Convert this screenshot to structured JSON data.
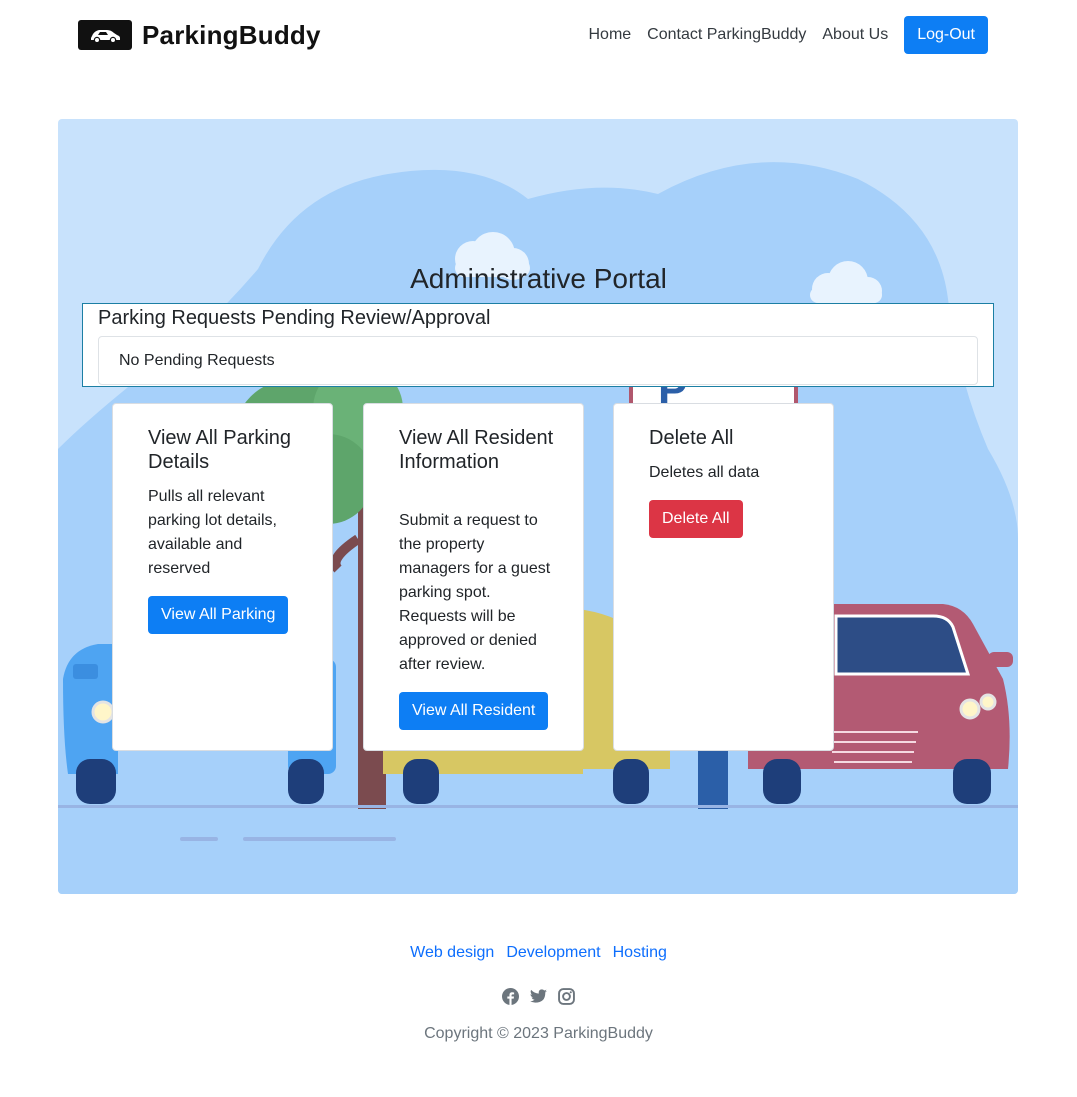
{
  "header": {
    "brand": "ParkingBuddy",
    "logo_icon": "car-icon",
    "nav": [
      "Home",
      "Contact ParkingBuddy",
      "About Us"
    ],
    "logout_label": "Log-Out"
  },
  "portal": {
    "title": "Administrative Portal",
    "requests_title": "Parking Requests Pending Review/Approval",
    "requests_empty": "No Pending Requests"
  },
  "cards": [
    {
      "title": "View All Parking Details",
      "text": "Pulls all relevant parking lot details, available and reserved",
      "button": "View All Parking"
    },
    {
      "title": "View All Resident Information",
      "text": "Submit a request to the property managers for a guest parking spot. Requests will be approved or denied after review.",
      "button": "View All Resident"
    },
    {
      "title": "Delete All",
      "text": "Deletes all data",
      "button": "Delete All"
    }
  ],
  "footer": {
    "links": [
      "Web design",
      "Development",
      "Hosting"
    ],
    "social_icons": [
      "facebook-icon",
      "twitter-icon",
      "instagram-icon"
    ],
    "copyright": "Copyright © 2023 ParkingBuddy"
  },
  "colors": {
    "primary": "#0d7ef4",
    "danger": "#dc3545",
    "hero_bg": "#c8e2fc",
    "link": "#0d6efd"
  }
}
